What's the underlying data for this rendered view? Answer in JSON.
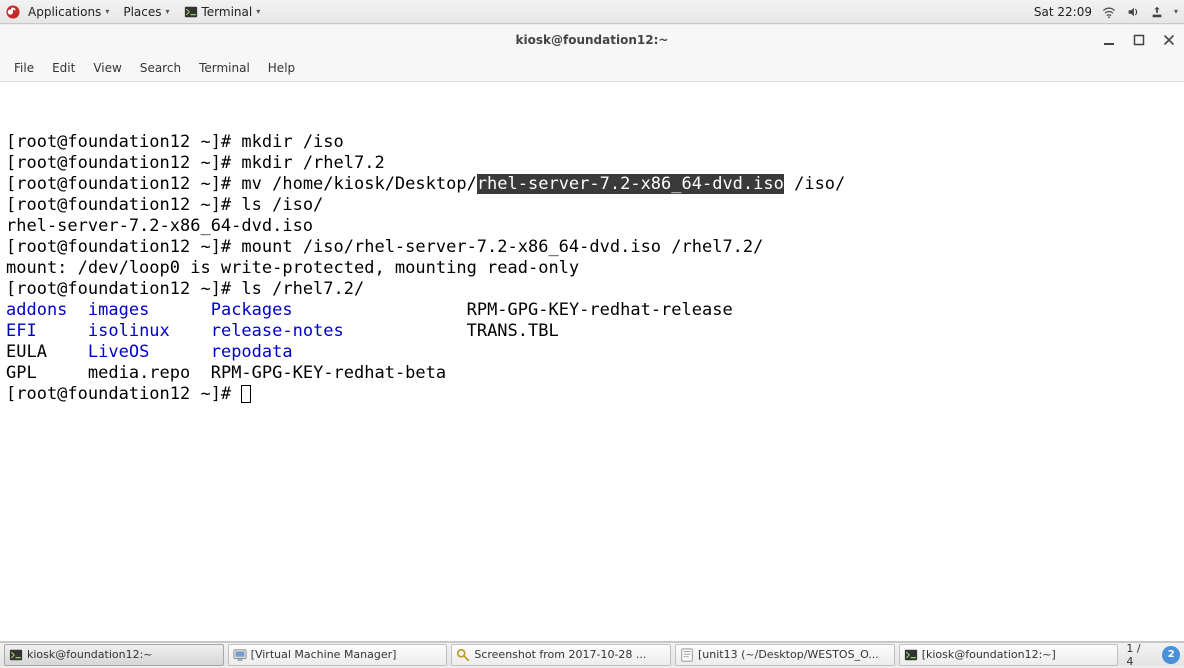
{
  "top_panel": {
    "applications": "Applications",
    "places": "Places",
    "terminal": "Terminal",
    "clock": "Sat 22:09"
  },
  "window": {
    "title": "kiosk@foundation12:~",
    "menu": {
      "file": "File",
      "edit": "Edit",
      "view": "View",
      "search": "Search",
      "terminal": "Terminal",
      "help": "Help"
    }
  },
  "terminal": {
    "prompt": "[root@foundation12 ~]# ",
    "line1_cmd": "mkdir /iso",
    "line2_cmd": "mkdir /rhel7.2",
    "line3_cmd_pre": "mv /home/kiosk/Desktop/",
    "line3_sel": "rhel-server-7.2-x86_64-dvd.iso",
    "line3_cmd_post": " /iso/",
    "line4_cmd": "ls /iso/",
    "line5": "rhel-server-7.2-x86_64-dvd.iso",
    "line6_cmd": "mount /iso/rhel-server-7.2-x86_64-dvd.iso /rhel7.2/",
    "line7": "mount: /dev/loop0 is write-protected, mounting read-only",
    "line8_cmd": "ls /rhel7.2/",
    "ls": {
      "addons": "addons",
      "EFI": "EFI",
      "EULA": "EULA",
      "GPL": "GPL",
      "images": "images",
      "isolinux": "isolinux",
      "LiveOS": "LiveOS",
      "media_repo": "media.repo",
      "Packages": "Packages",
      "release_notes": "release-notes",
      "repodata": "repodata",
      "RPM_beta": "RPM-GPG-KEY-redhat-beta",
      "RPM_release": "RPM-GPG-KEY-redhat-release",
      "TRANS_TBL": "TRANS.TBL"
    }
  },
  "taskbar": {
    "t1": "kiosk@foundation12:~",
    "t2": "[Virtual Machine Manager]",
    "t3": "Screenshot from 2017-10-28 ...",
    "t4": "[unit13 (~/Desktop/WESTOS_O...",
    "t5": "[kiosk@foundation12:~]",
    "workspace": "1 / 4",
    "notif_count": "2"
  }
}
